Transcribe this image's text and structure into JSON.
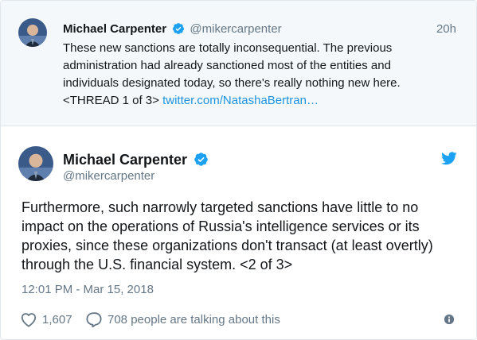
{
  "parent_tweet": {
    "author_name": "Michael Carpenter",
    "author_handle": "@mikercarpenter",
    "time": "20h",
    "text_lines": [
      "These new sanctions are totally inconsequential. The previous",
      "administration had already sanctioned most of the entities and",
      "individuals designated today, so there's really nothing new here.",
      "<THREAD 1 of 3> "
    ],
    "link": "twitter.com/NatashaBertran…"
  },
  "main_tweet": {
    "author_name": "Michael Carpenter",
    "author_handle": "@mikercarpenter",
    "text_lines": [
      "Furthermore, such narrowly targeted sanctions have little to no",
      "impact on the operations of Russia's intelligence services or its",
      "proxies, since these organizations don't transact (at least overtly)",
      "through the U.S. financial system.  <2 of 3>"
    ],
    "date": "12:01 PM - Mar 15, 2018",
    "likes": "1,607",
    "talking": "708 people are talking about this"
  },
  "icons": {
    "verified": "verified-badge-icon",
    "twitter_bird": "twitter-bird-icon",
    "like": "heart-icon",
    "reply": "speech-bubble-icon",
    "info": "info-icon"
  },
  "colors": {
    "accent": "#1da1f2",
    "link": "#1b95e0",
    "muted": "#657786",
    "parent_bg": "#f5f8fa"
  }
}
